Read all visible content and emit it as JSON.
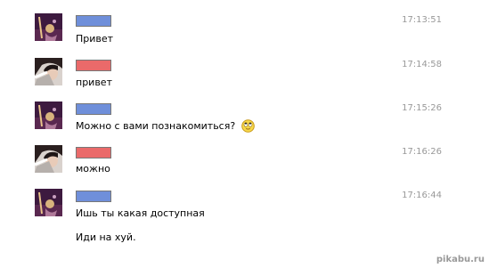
{
  "colors": {
    "user_a": "#6f8fda",
    "user_b": "#ea6a6a"
  },
  "messages": [
    {
      "sender": "user_a",
      "avatar": "purple-character-avatar",
      "time": "17:13:51",
      "lines": [
        "Привет"
      ]
    },
    {
      "sender": "user_b",
      "avatar": "girl-photo-avatar",
      "time": "17:14:58",
      "lines": [
        "привет"
      ]
    },
    {
      "sender": "user_a",
      "avatar": "purple-character-avatar",
      "time": "17:15:26",
      "lines": [
        "Можно с вами познакомиться?"
      ],
      "emoji": "rolling-eyes-smiley-icon"
    },
    {
      "sender": "user_b",
      "avatar": "girl-photo-avatar",
      "time": "17:16:26",
      "lines": [
        "можно"
      ]
    },
    {
      "sender": "user_a",
      "avatar": "purple-character-avatar",
      "time": "17:16:44",
      "lines": [
        "Ишь ты какая доступная",
        "Иди на хуй."
      ]
    }
  ],
  "watermark": "pikabu.ru"
}
